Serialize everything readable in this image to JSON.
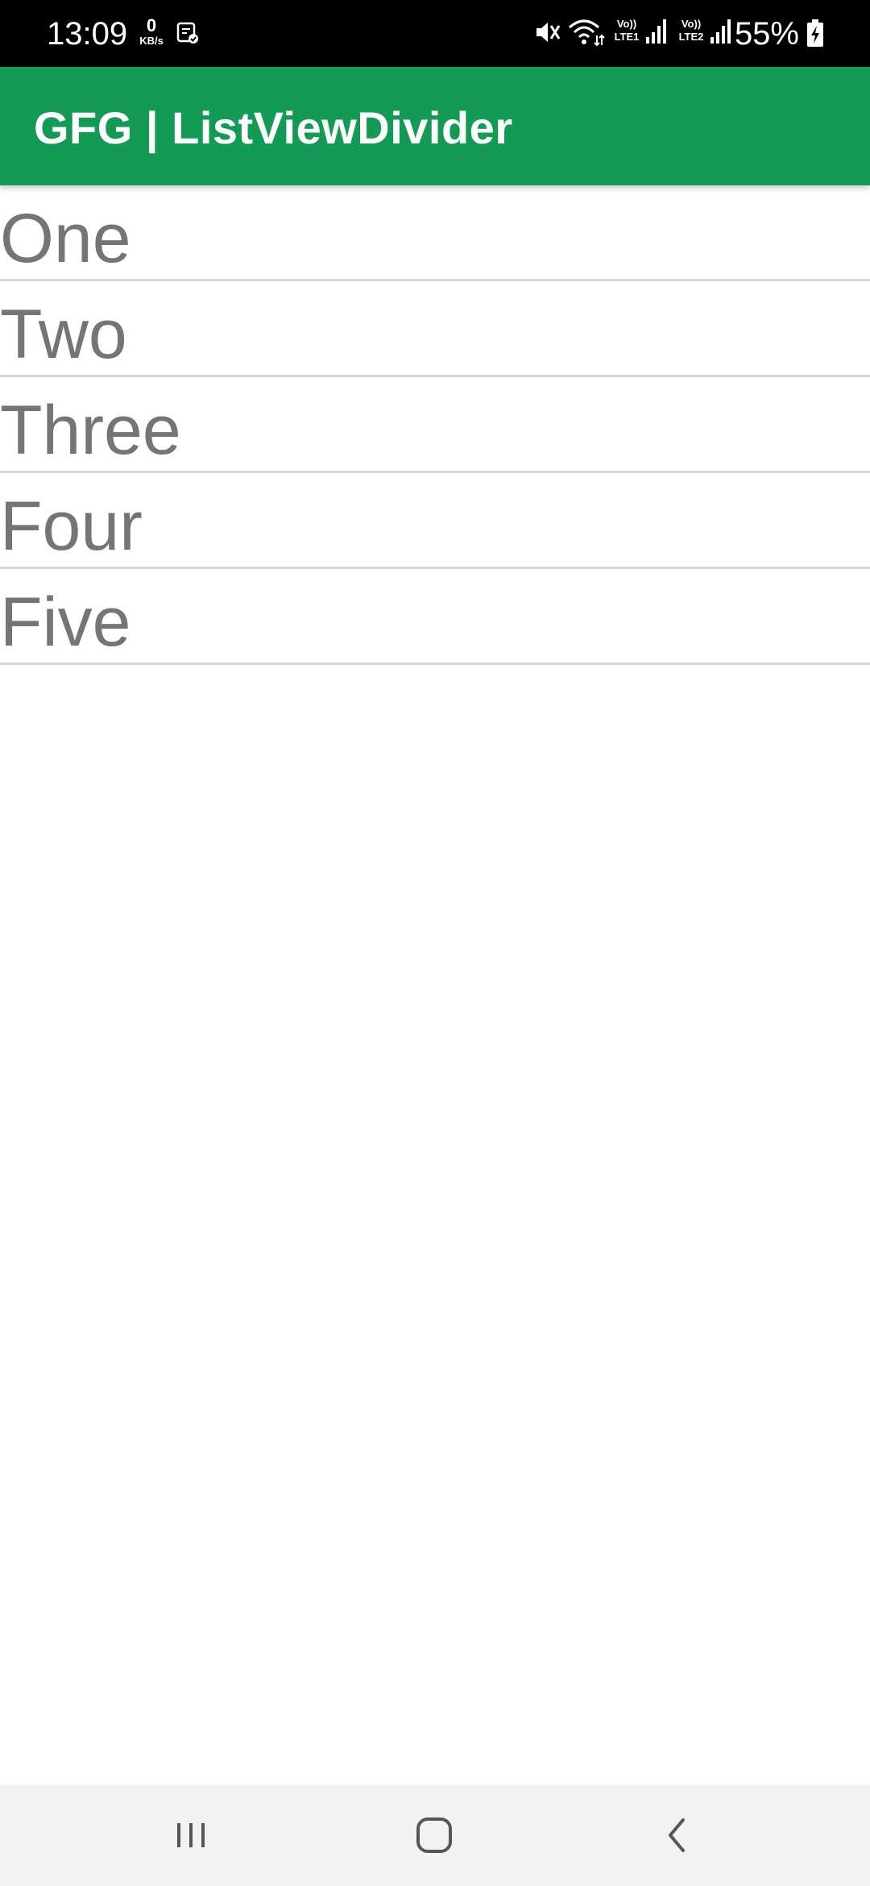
{
  "status_bar": {
    "time": "13:09",
    "net_speed_value": "0",
    "net_speed_unit": "KB/s",
    "sim1_label_top": "Vo))",
    "sim1_label_bottom": "LTE1",
    "sim2_label_top": "Vo))",
    "sim2_label_bottom": "LTE2",
    "battery_percent": "55%",
    "icons": [
      "notification-icon",
      "mute-icon",
      "wifi-icon",
      "signal-icon",
      "battery-charging-icon"
    ]
  },
  "app_bar": {
    "title": "GFG | ListViewDivider",
    "color": "#139b55"
  },
  "list": {
    "items": [
      "One",
      "Two",
      "Three",
      "Four",
      "Five"
    ],
    "text_color": "#757575",
    "divider_color": "#d8d8d8"
  },
  "nav_bar": {
    "buttons": [
      "recents-icon",
      "home-icon",
      "back-icon"
    ]
  }
}
